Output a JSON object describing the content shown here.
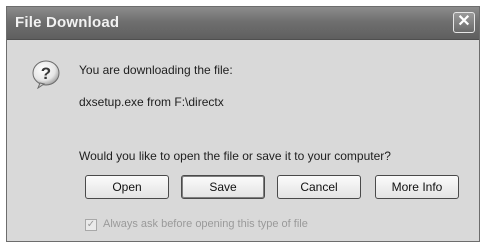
{
  "dialog": {
    "title": "File Download",
    "close_glyph": "✕",
    "icon": "question-icon",
    "message": "You are downloading the file:",
    "file_line": "dxsetup.exe from F:\\directx",
    "question": "Would you like to open the file or save it to your computer?",
    "buttons": {
      "open": "Open",
      "save": "Save",
      "cancel": "Cancel",
      "more_info": "More Info"
    },
    "checkbox": {
      "label": "Always ask before opening this type of file",
      "checked": true,
      "mark": "✓"
    }
  }
}
